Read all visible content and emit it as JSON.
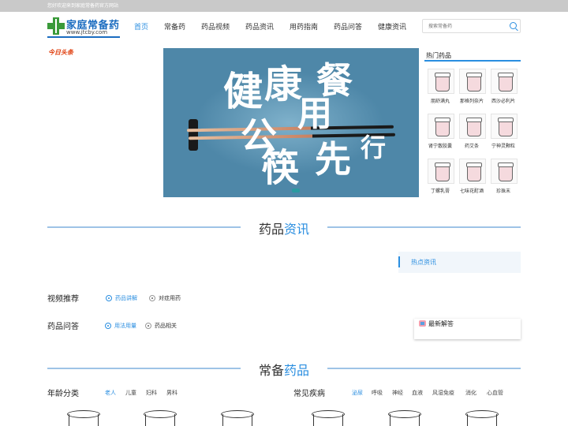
{
  "topbar": {
    "text": "您好欢迎来到家庭常备药官方网站"
  },
  "logo": {
    "name": "家庭常备药",
    "url": "www.jtcby.com"
  },
  "nav": {
    "items": [
      {
        "label": "首页",
        "active": true
      },
      {
        "label": "常备药"
      },
      {
        "label": "药品视频"
      },
      {
        "label": "药品资讯"
      },
      {
        "label": "用药指南"
      },
      {
        "label": "药品问答"
      },
      {
        "label": "健康资讯"
      }
    ]
  },
  "search": {
    "placeholder": "搜索常备药"
  },
  "headline": {
    "label": "今日头条"
  },
  "banner": {
    "chars": [
      "健",
      "康",
      "餐",
      "用",
      "公",
      "筷",
      "先",
      "行"
    ]
  },
  "hot_drugs": {
    "title": "热门药品",
    "items": [
      "朋舒满丸",
      "那格列奈片",
      "西沙必利片",
      "肾宁散胶囊",
      "药艾条",
      "宁神灵颗粒",
      "丁螺乳膏",
      "七味花酊酒",
      "珍珠末"
    ]
  },
  "section_news": {
    "title_plain": "药品",
    "title_accent": "资讯"
  },
  "hot_news": {
    "label": "热点资讯"
  },
  "video": {
    "title": "视频推荐",
    "tabs": [
      {
        "label": "药品讲解",
        "active": true
      },
      {
        "label": "对症用药"
      }
    ]
  },
  "qa": {
    "title": "药品问答",
    "tabs": [
      {
        "label": "用法用量",
        "active": true
      },
      {
        "label": "药品相关"
      }
    ]
  },
  "latest_answers": {
    "label": "最新解答"
  },
  "section_common": {
    "title_plain": "常备",
    "title_accent": "药品"
  },
  "age": {
    "title": "年龄分类",
    "items": [
      {
        "label": "老人",
        "active": true
      },
      {
        "label": "儿童"
      },
      {
        "label": "妇科"
      },
      {
        "label": "男科"
      }
    ]
  },
  "disease": {
    "title": "常见疾病",
    "items": [
      {
        "label": "泌尿",
        "active": true
      },
      {
        "label": "呼吸"
      },
      {
        "label": "神经"
      },
      {
        "label": "血液"
      },
      {
        "label": "风湿免疫"
      },
      {
        "label": "消化"
      },
      {
        "label": "心血管"
      }
    ]
  },
  "colors": {
    "accent": "#2a8ee0",
    "headline": "#e04010",
    "brand_green": "#3a9a3a"
  }
}
